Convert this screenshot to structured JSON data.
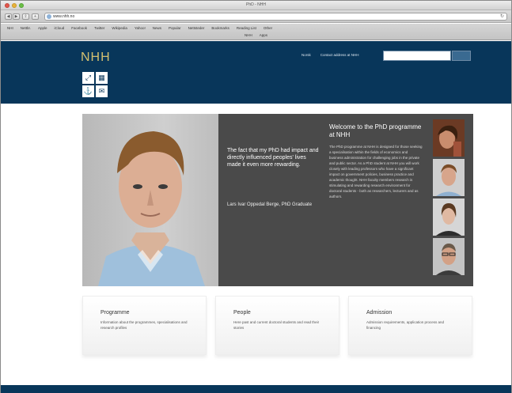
{
  "browser": {
    "window_title": "PhD - NHH",
    "url": "www.nhh.no",
    "bookmarks_row1": [
      "NHI",
      "Nettbr.",
      "Apple",
      "iCloud",
      "Facebook",
      "Twitter",
      "Wikipedia",
      "Yahoo!",
      "News",
      "Popular",
      "Nettsteder",
      "Bookmarks",
      "Reading List",
      "Other"
    ],
    "bookmarks_row2": [
      "NHH",
      "Apps"
    ]
  },
  "site": {
    "logo": "NHH",
    "header_links": [
      "Norsk",
      "Contact address at NHH"
    ],
    "tiles": [
      {
        "icon": "resize-icon",
        "glyph": "⤢"
      },
      {
        "icon": "grid-icon",
        "glyph": "▦"
      },
      {
        "icon": "anchor-icon",
        "glyph": "⚓"
      },
      {
        "icon": "mail-icon",
        "glyph": "✉"
      }
    ]
  },
  "hero": {
    "quote": "The fact that my PhD had impact and directly influenced peoples' lives made it even more rewarding.",
    "attribution": "Lars Ivar Oppedal Berge, PhD Graduate",
    "welcome_title": "Welcome to the PhD programme at NHH",
    "welcome_body": "The PhD programme at NHH is designed for those seeking a specialisation within the fields of economics and business administration for challenging jobs in the private and public sector. As a PhD student at NHH you will work closely with leading professors who have a significant impact on government policies, business practice and academic thought. NHH faculty members research is stimulating and rewarding research environment for doctoral students - both as researchers, lecturers and as authors."
  },
  "cards": [
    {
      "title": "Programme",
      "desc": "Information about the programmes, specialisations and research profiles"
    },
    {
      "title": "People",
      "desc": "Here past and current doctoral students and read their stories"
    },
    {
      "title": "Admission",
      "desc": "Admission requirements, application process and financing"
    }
  ]
}
